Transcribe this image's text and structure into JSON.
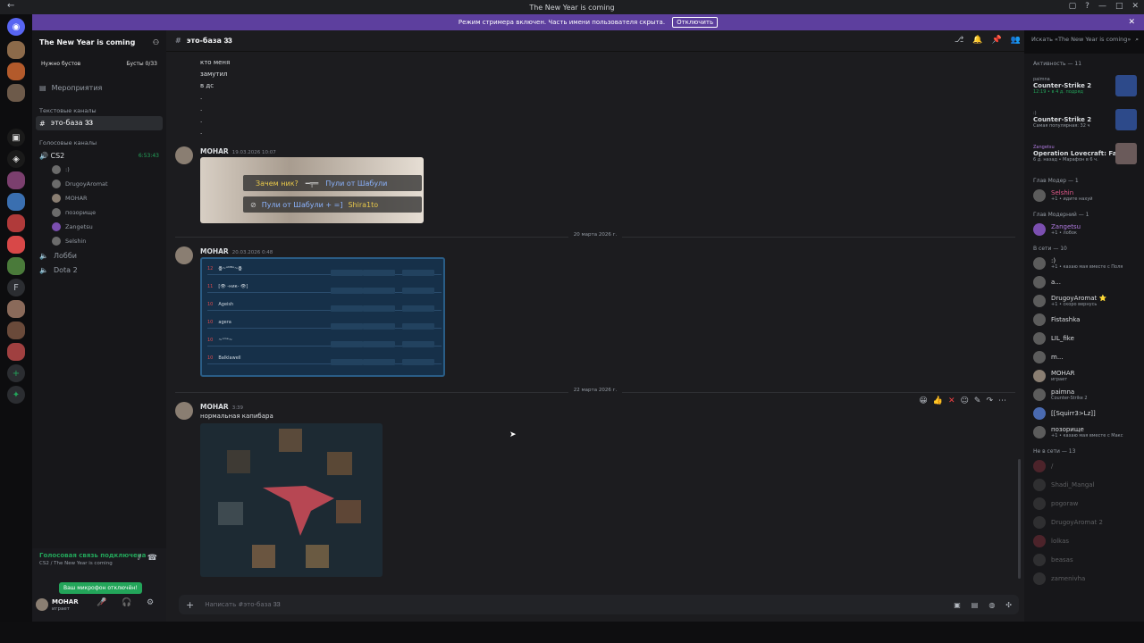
{
  "window": {
    "title": "The New Year is coming"
  },
  "banner": {
    "text": "Режим стримера включен. Часть имени пользователя скрыта.",
    "button": "Отключить"
  },
  "server": {
    "name": "The New Year is coming",
    "boost_label": "Нужно бустов",
    "boost_count": "Бусты 0/33"
  },
  "sidebar": {
    "events": "Мероприятия",
    "text_category": "Текстовые каналы",
    "active_channel": "это-база 𝟑𝟑",
    "voice_category": "Голосовые каналы",
    "voice_channels": [
      {
        "name": "CS2",
        "timer": "6:53:43"
      },
      {
        "name": "Лобби"
      },
      {
        "name": "Dota 2"
      }
    ],
    "voice_users": [
      ":)",
      "DrugoyAromat",
      "MOHAR",
      "позорище",
      "Zangetsu",
      "Selshin"
    ]
  },
  "voice_panel": {
    "status": "Голосовая связь подключена",
    "location": "CS2 / The New Year is coming",
    "toast": "Ваш микрофон отключён!",
    "user": "MOHAR",
    "user_status": "играет"
  },
  "channel": {
    "header": "это-база 𝟑𝟑",
    "search_placeholder": "Искать «The New Year is coming»"
  },
  "messages": {
    "top_lines": [
      "кто меня",
      "замутил",
      "в дс",
      ".",
      ".",
      ".",
      "."
    ],
    "m1": {
      "author": "MOHAR",
      "time": "19.03.2026 10:07",
      "img_line1": "Зачем ник?",
      "img_line1b": "Пули от Шабули",
      "img_line2": "Пули от Шабули + =]",
      "img_line2b": "Shira1to"
    },
    "date1": "20 марта 2026 г.",
    "m2": {
      "author": "MOHAR",
      "time": "20.03.2026 0:48",
      "ranks": [
        "12",
        "11",
        "10",
        "10",
        "10",
        "10"
      ],
      "names": [
        "ꙮ~ᴬᴹᴮᴬ~ꙮ",
        "[👁 -ник- 👁]",
        "Ageish",
        "agera",
        "~ᵒᵐᵉ~",
        "Balklawell"
      ]
    },
    "date2": "22 марта 2026 г.",
    "m3": {
      "author": "MOHAR",
      "time": "3:39",
      "text": "нормальная капибара"
    }
  },
  "composer": {
    "placeholder": "Написать #это-база 𝟑𝟑"
  },
  "members": {
    "activity_header": "Активность — 11",
    "activities": [
      {
        "user": "paimna",
        "game": "Counter-Strike 2",
        "meta": "12:19 • в 4 д. подряд"
      },
      {
        "user": ":)",
        "game": "Counter-Strike 2",
        "meta": "Самая популярная: 32 ч"
      },
      {
        "user": "Zangetsu",
        "game": "Operation Lovecraft: Falle...",
        "meta": "6 д. назад • Марафон в 6 ч."
      }
    ],
    "sec_mod": "Глав Модер — 1",
    "mod_user": "Selshin",
    "mod_sub": "+1 • идите нахуй",
    "sec_mod2": "Глав Модерний — 1",
    "mod2_user": "Zangetsu",
    "mod2_sub": "+1 • лобок",
    "sec_online": "В сети — 10",
    "online": [
      {
        "name": ":)",
        "sub": "+1 • кахаю мая вместе с Поля"
      },
      {
        "name": "a...",
        "sub": ""
      },
      {
        "name": "DrugoyAromat ⭐",
        "sub": "+1 • скоро вернусь"
      },
      {
        "name": "Fistashka",
        "sub": ""
      },
      {
        "name": "LIL_fike",
        "sub": ""
      },
      {
        "name": "m...",
        "sub": ""
      },
      {
        "name": "MOHAR",
        "sub": "играет"
      },
      {
        "name": "paimna",
        "sub": "Counter-Strike 2"
      },
      {
        "name": "[[Squirr3>Lz]]",
        "sub": ""
      },
      {
        "name": "позорище",
        "sub": "+1 • кахаю мая вместе с Макс"
      }
    ],
    "sec_offline": "Не в сети — 13",
    "offline": [
      "/",
      "Shadi_Mangal",
      "pogoraw",
      "DrugoyAromat 2",
      "lolkas",
      "beasas",
      "zamenivha"
    ]
  }
}
